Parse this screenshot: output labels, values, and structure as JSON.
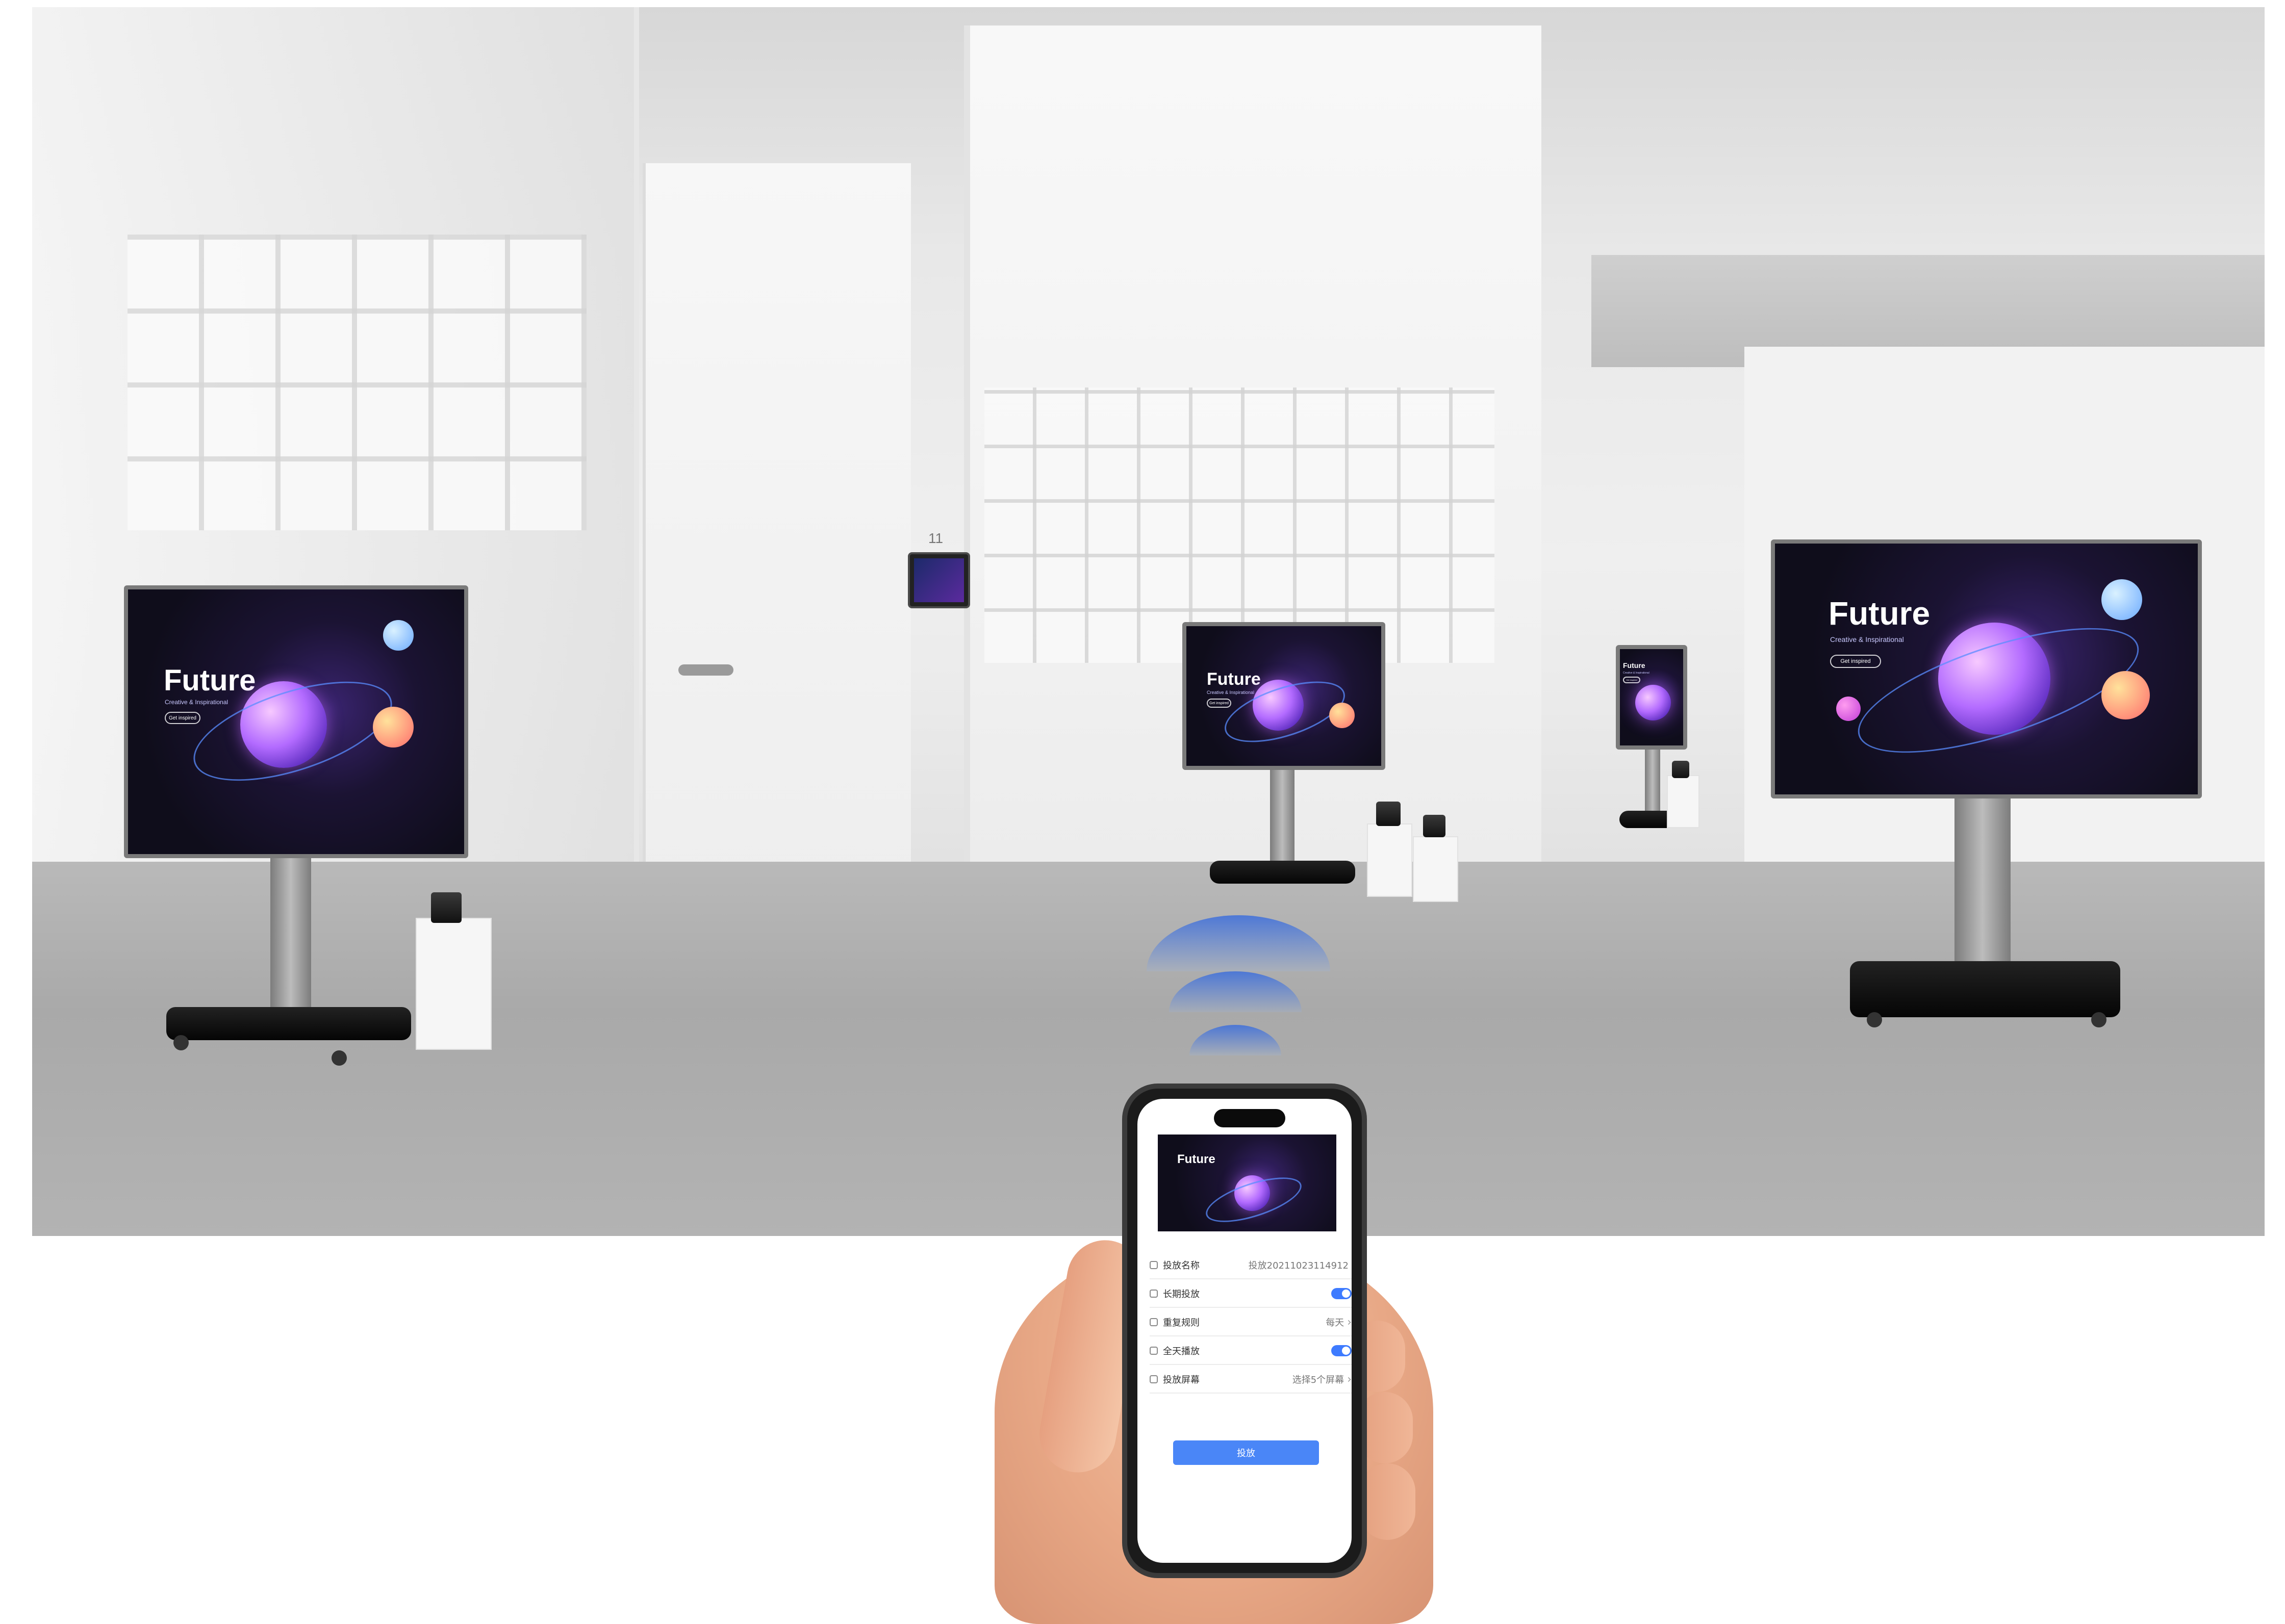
{
  "wall_sign": {
    "room_number": "11"
  },
  "displays": [
    {
      "screen": {
        "title": "Future",
        "subtitle": "Creative & Inspirational",
        "button": "Get inspired"
      }
    },
    {
      "screen": {
        "title": "Future",
        "subtitle": "Creative & Inspirational",
        "button": "Get inspired"
      }
    },
    {
      "screen": {
        "title": "Future",
        "subtitle": "Creative & Inspirational",
        "button": "Get inspired"
      }
    },
    {
      "screen": {
        "title": "Future",
        "subtitle": "Creative & Inspirational",
        "button": "Get inspired"
      }
    }
  ],
  "phone": {
    "banner_title": "Future",
    "form": {
      "rows": [
        {
          "label": "投放名称",
          "value": "投放20211023114912",
          "icon": "document-icon",
          "control": "text"
        },
        {
          "label": "长期投放",
          "value": "",
          "icon": "calendar-icon",
          "control": "toggle",
          "toggle_on": true
        },
        {
          "label": "重复规则",
          "value": "每天",
          "icon": "repeat-icon",
          "control": "chevron"
        },
        {
          "label": "全天播放",
          "value": "",
          "icon": "clock-icon",
          "control": "toggle",
          "toggle_on": true
        },
        {
          "label": "投放屏幕",
          "value": "选择5个屏幕",
          "icon": "screen-icon",
          "control": "chevron"
        }
      ]
    },
    "submit_label": "投放",
    "accent_color": "#4a86f7"
  }
}
